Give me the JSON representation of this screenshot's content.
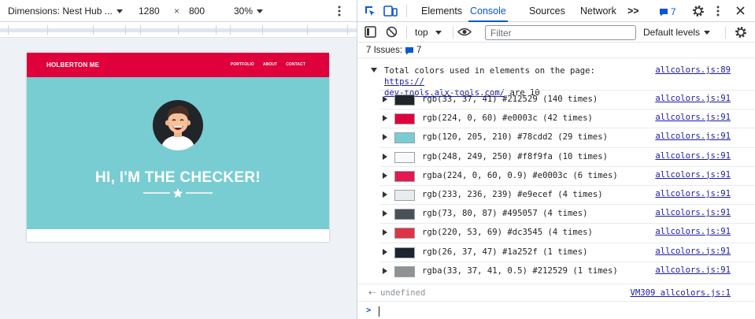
{
  "device_toolbar": {
    "dimensions": "Dimensions: Nest Hub ...",
    "width": "1280",
    "times": "×",
    "height": "800",
    "zoom": "30%"
  },
  "site": {
    "logo": "HOLBERTON ME",
    "nav": [
      "PORTFOLIO",
      "ABOUT",
      "CONTACT"
    ],
    "hero_title": "HI, I'M THE CHECKER!",
    "colors": {
      "nav": "#e0003c",
      "hero": "#78cdd2",
      "avatar_bg": "#212529"
    }
  },
  "devtools": {
    "tabs": [
      "Elements",
      "Console",
      "Sources",
      "Network"
    ],
    "active_tab": "Console",
    "more_tabs": ">>",
    "issues_badge": "7",
    "context": "top",
    "filter_placeholder": "Filter",
    "levels": "Default levels",
    "issues_label": "7 Issues:",
    "issues_count": "7"
  },
  "console": {
    "summary_prefix": "Total colors used in elements on the page: ",
    "summary_link_1": "https://",
    "summary_link_2": "dev-tools.alx-tools.com/",
    "summary_suffix": " are 10",
    "summary_source": "allcolors.js:89",
    "entries": [
      {
        "text": "rgb(33, 37, 41) #212529 (140 times)",
        "color": "#212529",
        "source": "allcolors.js:91"
      },
      {
        "text": "rgb(224, 0, 60) #e0003c (42 times)",
        "color": "#e0003c",
        "source": "allcolors.js:91"
      },
      {
        "text": "rgb(120, 205, 210) #78cdd2 (29 times)",
        "color": "#78cdd2",
        "source": "allcolors.js:91"
      },
      {
        "text": "rgb(248, 249, 250) #f8f9fa (10 times)",
        "color": "#f8f9fa",
        "source": "allcolors.js:91"
      },
      {
        "text": "rgba(224, 0, 60, 0.9) #e0003c (6 times)",
        "color": "rgba(224,0,60,0.9)",
        "source": "allcolors.js:91"
      },
      {
        "text": "rgb(233, 236, 239) #e9ecef (4 times)",
        "color": "#e9ecef",
        "source": "allcolors.js:91"
      },
      {
        "text": "rgb(73, 80, 87) #495057 (4 times)",
        "color": "#495057",
        "source": "allcolors.js:91"
      },
      {
        "text": "rgb(220, 53, 69) #dc3545 (4 times)",
        "color": "#dc3545",
        "source": "allcolors.js:91"
      },
      {
        "text": "rgb(26, 37, 47) #1a252f (1 times)",
        "color": "#1a252f",
        "source": "allcolors.js:91"
      },
      {
        "text": "rgba(33, 37, 41, 0.5) #212529 (1 times)",
        "color": "rgba(33,37,41,0.5)",
        "source": "allcolors.js:91"
      }
    ],
    "return_value": "undefined",
    "return_source": "VM309 allcolors.js:1",
    "prompt": ">"
  }
}
